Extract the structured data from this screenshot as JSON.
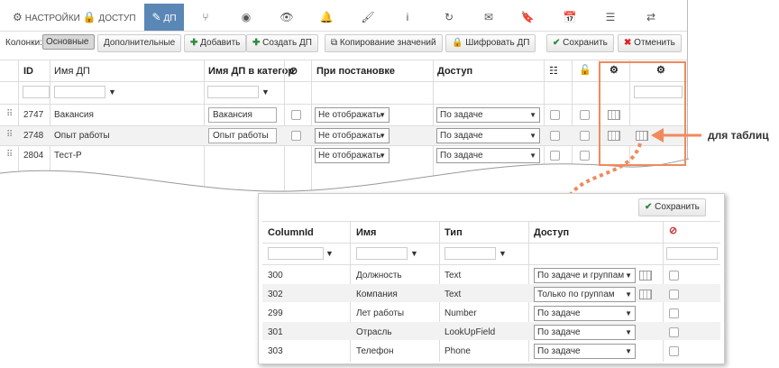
{
  "tabs": [
    {
      "name": "tab-settings",
      "icon": "gear-icon",
      "glyph": "⚙",
      "label": "НАСТРОЙКИ"
    },
    {
      "name": "tab-access",
      "icon": "lock-icon",
      "glyph": "🔒",
      "label": "ДОСТУП"
    },
    {
      "name": "tab-dp",
      "icon": "edit-icon",
      "glyph": "✎",
      "label": "ДП"
    },
    {
      "name": "tab-branch",
      "icon": "branch-icon",
      "glyph": "⑂",
      "label": ""
    },
    {
      "name": "tab-play",
      "icon": "play-icon",
      "glyph": "◉",
      "label": ""
    },
    {
      "name": "tab-view",
      "icon": "eye-icon",
      "glyph": "👁",
      "label": ""
    },
    {
      "name": "tab-bell",
      "icon": "bell-icon",
      "glyph": "🔔",
      "label": ""
    },
    {
      "name": "tab-brush",
      "icon": "brush-icon",
      "glyph": "🖌",
      "label": ""
    },
    {
      "name": "tab-info",
      "icon": "info-icon",
      "glyph": "i",
      "label": ""
    },
    {
      "name": "tab-refresh",
      "icon": "refresh-icon",
      "glyph": "↻",
      "label": ""
    },
    {
      "name": "tab-mail",
      "icon": "mail-icon",
      "glyph": "✉",
      "label": ""
    },
    {
      "name": "tab-bookmark",
      "icon": "bookmark-icon",
      "glyph": "🔖",
      "label": ""
    },
    {
      "name": "tab-calendar",
      "icon": "calendar-icon",
      "glyph": "📅",
      "label": ""
    },
    {
      "name": "tab-database",
      "icon": "database-icon",
      "glyph": "☰",
      "label": ""
    },
    {
      "name": "tab-sync",
      "icon": "sync-icon",
      "glyph": "⇄",
      "label": ""
    }
  ],
  "toolbar": {
    "columns_label": "Колонки:",
    "basic": "Основные",
    "additional": "Дополнительные",
    "add": "Добавить",
    "create_dp": "Создать ДП",
    "copy_values": "Копирование значений",
    "encrypt_dp": "Шифровать ДП",
    "save": "Сохранить",
    "cancel": "Отменить"
  },
  "main_table": {
    "headers": {
      "id": "ID",
      "name": "Имя ДП",
      "name_cat": "Имя ДП в категор",
      "on_set": "При постановке",
      "access": "Доступ"
    },
    "rows": [
      {
        "id": "2747",
        "name": "Вакансия",
        "name_cat": "Вакансия",
        "on_set": "Не отображать",
        "access": "По задаче"
      },
      {
        "id": "2748",
        "name": "Опыт работы",
        "name_cat": "Опыт работы",
        "on_set": "Не отображать",
        "access": "По задаче"
      },
      {
        "id": "2804",
        "name": "Тест-Р",
        "name_cat": "",
        "on_set": "Не отображать",
        "access": "По задаче"
      }
    ]
  },
  "callout": {
    "label": "для таблиц",
    "color": "#f08a5d"
  },
  "sub_table": {
    "save": "Сохранить",
    "headers": {
      "col_id": "ColumnId",
      "name": "Имя",
      "type": "Тип",
      "access": "Доступ"
    },
    "rows": [
      {
        "col_id": "300",
        "name": "Должность",
        "type": "Text",
        "access": "По задаче и группам",
        "table_icon": true
      },
      {
        "col_id": "302",
        "name": "Компания",
        "type": "Text",
        "access": "Только по группам",
        "table_icon": true
      },
      {
        "col_id": "299",
        "name": "Лет работы",
        "type": "Number",
        "access": "По задаче",
        "table_icon": false
      },
      {
        "col_id": "301",
        "name": "Отрасль",
        "type": "LookUpField",
        "access": "По задаче",
        "table_icon": false
      },
      {
        "col_id": "303",
        "name": "Телефон",
        "type": "Phone",
        "access": "По задаче",
        "table_icon": false
      }
    ]
  }
}
